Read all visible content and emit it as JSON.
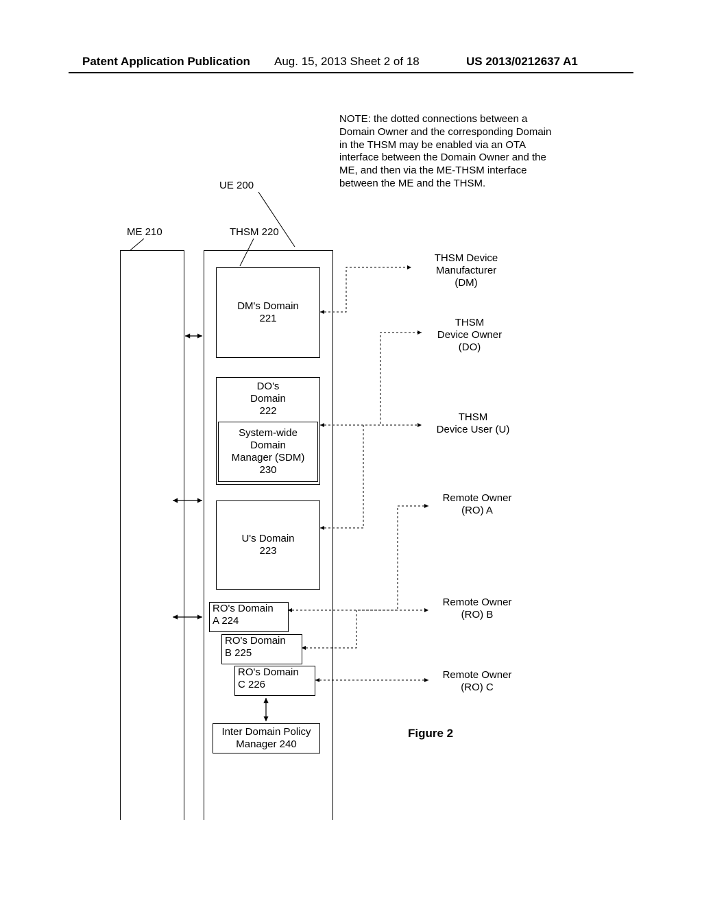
{
  "header": {
    "left": "Patent Application Publication",
    "center": "Aug. 15, 2013  Sheet 2 of 18",
    "right": "US 2013/0212637 A1"
  },
  "note": "NOTE: the dotted connections between a Domain Owner and the corresponding Domain in the THSM may be enabled via an OTA interface between the Domain Owner and the ME, and then via the ME-THSM interface between the ME and the THSM.",
  "labels": {
    "ue": "UE 200",
    "me": "ME 210",
    "thsm": "THSM 220"
  },
  "boxes": {
    "dm_domain_l1": "DM's Domain",
    "dm_domain_l2": "221",
    "do_domain_l1": "DO's",
    "do_domain_l2": "Domain",
    "do_domain_l3": "222",
    "sdm_l1": "System-wide",
    "sdm_l2": "Domain",
    "sdm_l3": "Manager (SDM)",
    "sdm_l4": "230",
    "u_domain_l1": "U's Domain",
    "u_domain_l2": "223",
    "roA_l1": "RO's Domain",
    "roA_l2": "A 224",
    "roB_l1": "RO's Domain",
    "roB_l2": "B 225",
    "roC_l1": "RO's Domain",
    "roC_l2": "C 226",
    "idpm_l1": "Inter Domain Policy",
    "idpm_l2": "Manager 240"
  },
  "owners": {
    "dm_l1": "THSM Device",
    "dm_l2": "Manufacturer",
    "dm_l3": "(DM)",
    "do_l1": "THSM",
    "do_l2": "Device Owner",
    "do_l3": "(DO)",
    "u_l1": "THSM",
    "u_l2": "Device User (U)",
    "roA_l1": "Remote Owner",
    "roA_l2": "(RO) A",
    "roB_l1": "Remote Owner",
    "roB_l2": "(RO) B",
    "roC_l1": "Remote Owner",
    "roC_l2": "(RO) C"
  },
  "figure": "Figure 2"
}
